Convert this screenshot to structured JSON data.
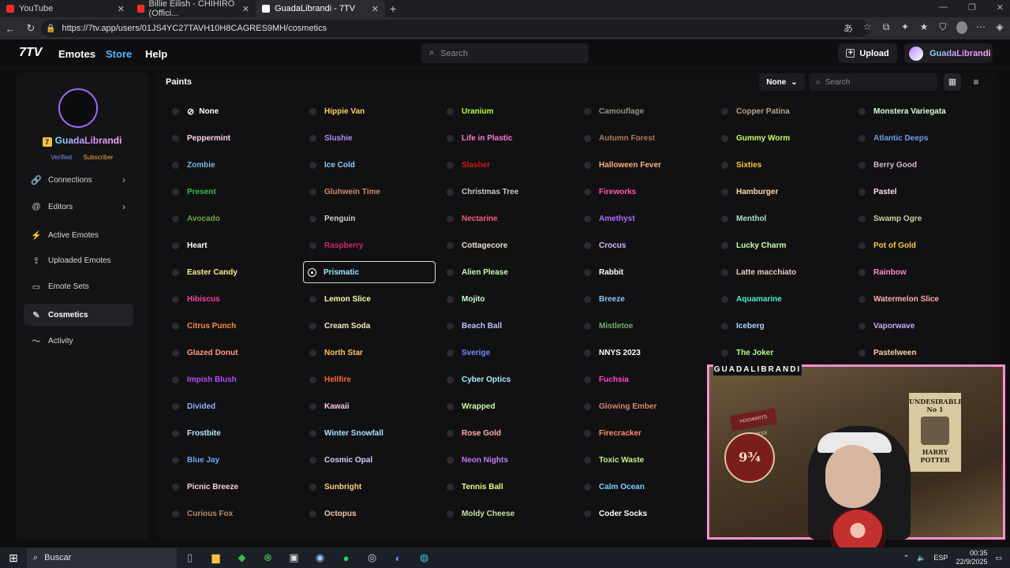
{
  "browser": {
    "tabs": [
      {
        "title": "YouTube",
        "fav_color": "#ff2b2b"
      },
      {
        "title": "Billie Eilish - CHIHIRO (Offici...",
        "fav_color": "#ff2b2b"
      },
      {
        "title": "GuadaLibrandi - 7TV",
        "fav_color": "#ffffff"
      }
    ],
    "url": "https://7tv.app/users/01JS4YC27TAVH10H8CAGRES9MH/cosmetics"
  },
  "header": {
    "logo": "7TV",
    "nav": [
      "Emotes",
      "Store",
      "Help"
    ],
    "search_placeholder": "Search",
    "upload_label": "Upload",
    "username": "GuadaLibrandi"
  },
  "sidebar": {
    "username": "GuadaLibrandi",
    "badges": [
      "Verified",
      "Subscriber"
    ],
    "items": [
      {
        "label": "Connections",
        "icon": "link-icon",
        "glyph": "🔗",
        "chevron": true
      },
      {
        "label": "Editors",
        "icon": "at-icon",
        "glyph": "@",
        "chevron": true
      },
      {
        "label": "Active Emotes",
        "icon": "bolt-icon",
        "glyph": "⚡",
        "chevron": false
      },
      {
        "label": "Uploaded Emotes",
        "icon": "upload-icon",
        "glyph": "⇪",
        "chevron": false
      },
      {
        "label": "Emote Sets",
        "icon": "folder-icon",
        "glyph": "▭",
        "chevron": false
      },
      {
        "label": "Cosmetics",
        "icon": "brush-icon",
        "glyph": "✎",
        "chevron": false,
        "active": true
      },
      {
        "label": "Activity",
        "icon": "activity-icon",
        "glyph": "〜",
        "chevron": false
      }
    ]
  },
  "main": {
    "title": "Paints",
    "filter_label": "None",
    "search_placeholder": "Search",
    "columns": [
      [
        {
          "name": "None",
          "color": "#ffffff"
        },
        {
          "name": "Peppermint",
          "color": "#ffd6e8"
        },
        {
          "name": "Zombie",
          "color": "#7fb6d8"
        },
        {
          "name": "Present",
          "color": "#2fbf4a"
        },
        {
          "name": "Avocado",
          "color": "#6faa3a"
        },
        {
          "name": "Heart",
          "color": "#ffffff"
        },
        {
          "name": "Easter Candy",
          "color": "#f7f08a"
        },
        {
          "name": "Hibiscus",
          "color": "#ff3fa4"
        },
        {
          "name": "Citrus Punch",
          "color": "#ff8a3d"
        },
        {
          "name": "Glazed Donut",
          "color": "#ff9b7a"
        },
        {
          "name": "Impish Blush",
          "color": "#b54cff"
        },
        {
          "name": "Divided",
          "color": "#8fb0ff"
        },
        {
          "name": "Frostbite",
          "color": "#bfe4ff"
        },
        {
          "name": "Blue Jay",
          "color": "#6ea8ff"
        },
        {
          "name": "Picnic Breeze",
          "color": "#ffd0d0"
        },
        {
          "name": "Curious Fox",
          "color": "#b88a6a"
        }
      ],
      [
        {
          "name": "Hippie Van",
          "color": "#f5d56a"
        },
        {
          "name": "Slushie",
          "color": "#b889ff"
        },
        {
          "name": "Ice Cold",
          "color": "#8fd0ff"
        },
        {
          "name": "Gluhwein Time",
          "color": "#d08a6a"
        },
        {
          "name": "Penguin",
          "color": "#cfcfcf"
        },
        {
          "name": "Raspberry",
          "color": "#d6246a"
        },
        {
          "name": "Prismatic",
          "color": "#9be7ff"
        },
        {
          "name": "Lemon Slice",
          "color": "#fff6a8"
        },
        {
          "name": "Cream Soda",
          "color": "#ffe7c2"
        },
        {
          "name": "North Star",
          "color": "#ffc15a"
        },
        {
          "name": "Hellfire",
          "color": "#ff6a2a"
        },
        {
          "name": "Kawaii",
          "color": "#ffc6f2"
        },
        {
          "name": "Winter Snowfall",
          "color": "#a8e4ff"
        },
        {
          "name": "Cosmic Opal",
          "color": "#d7d0ff"
        },
        {
          "name": "Sunbright",
          "color": "#ffd27a"
        },
        {
          "name": "Octopus",
          "color": "#f0c7b0"
        }
      ],
      [
        {
          "name": "Uranium",
          "color": "#b6ff3a"
        },
        {
          "name": "Life in Plastic",
          "color": "#ff7ad0"
        },
        {
          "name": "Slasher",
          "color": "#d21a1a"
        },
        {
          "name": "Christmas Tree",
          "color": "#c9c9c9"
        },
        {
          "name": "Nectarine",
          "color": "#ff5a7a"
        },
        {
          "name": "Cottagecore",
          "color": "#e8e0d0"
        },
        {
          "name": "Alien Please",
          "color": "#c6ffb0"
        },
        {
          "name": "Mojito",
          "color": "#c8ffd0"
        },
        {
          "name": "Beach Ball",
          "color": "#bfbfff"
        },
        {
          "name": "Sverige",
          "color": "#6a8fff"
        },
        {
          "name": "Cyber Optics",
          "color": "#a8f0ff"
        },
        {
          "name": "Wrapped",
          "color": "#c8ff9a"
        },
        {
          "name": "Rose Gold",
          "color": "#ffb0a8"
        },
        {
          "name": "Neon Nights",
          "color": "#c47bff"
        },
        {
          "name": "Tennis Ball",
          "color": "#e6ff7a"
        },
        {
          "name": "Moldy Cheese",
          "color": "#c8e0a0"
        }
      ],
      [
        {
          "name": "Camouflage",
          "color": "#8a9a7a"
        },
        {
          "name": "Autumn Forest",
          "color": "#b07a5a"
        },
        {
          "name": "Halloween Fever",
          "color": "#ffb07a"
        },
        {
          "name": "Fireworks",
          "color": "#ff5ab0"
        },
        {
          "name": "Amethyst",
          "color": "#b06aff"
        },
        {
          "name": "Crocus",
          "color": "#d8b8ff"
        },
        {
          "name": "Rabbit",
          "color": "#ffffff"
        },
        {
          "name": "Breeze",
          "color": "#8ac8ff"
        },
        {
          "name": "Mistletoe",
          "color": "#6ab06a"
        },
        {
          "name": "NNYS 2023",
          "color": "#ffffff"
        },
        {
          "name": "Fuchsia",
          "color": "#ff4ac8"
        },
        {
          "name": "Glowing Ember",
          "color": "#d8846a"
        },
        {
          "name": "Firecracker",
          "color": "#ff8a6a"
        },
        {
          "name": "Toxic Waste",
          "color": "#c8f08a"
        },
        {
          "name": "Calm Ocean",
          "color": "#7ad0ff"
        },
        {
          "name": "Coder Socks",
          "color": "#ffffff"
        }
      ],
      [
        {
          "name": "Copper Patina",
          "color": "#b8a488"
        },
        {
          "name": "Gummy Worm",
          "color": "#c8ff6a"
        },
        {
          "name": "Sixties",
          "color": "#ffc83a"
        },
        {
          "name": "Hamburger",
          "color": "#ffd9a8"
        },
        {
          "name": "Menthol",
          "color": "#a8e6c8"
        },
        {
          "name": "Lucky Charm",
          "color": "#c8ffb0"
        },
        {
          "name": "Latte macchiato",
          "color": "#e8d0b8"
        },
        {
          "name": "Aquamarine",
          "color": "#4af0d0"
        },
        {
          "name": "Iceberg",
          "color": "#a8d8ff"
        },
        {
          "name": "The Joker",
          "color": "#b0ff8a"
        }
      ],
      [
        {
          "name": "Monstera Variegata",
          "color": "#d8ffd0"
        },
        {
          "name": "Atlantic Deeps",
          "color": "#6aa0e8"
        },
        {
          "name": "Berry Good",
          "color": "#d8b8c8"
        },
        {
          "name": "Pastel",
          "color": "#ffe0f0"
        },
        {
          "name": "Swamp Ogre",
          "color": "#c8d8a0"
        },
        {
          "name": "Pot of Gold",
          "color": "#ffc84a"
        },
        {
          "name": "Rainbow",
          "color": "#ff8ad0"
        },
        {
          "name": "Watermelon Slice",
          "color": "#ffb0a0"
        },
        {
          "name": "Vaporwave",
          "color": "#d0a8ff"
        },
        {
          "name": "Pastelween",
          "color": "#ffd0a0"
        }
      ]
    ],
    "selected": "Prismatic"
  },
  "stream": {
    "overlay_label": "GUADALIBRANDI",
    "poster_title": "UNDESIRABLE",
    "poster_no": "No 1",
    "poster_name": "HARRY POTTER",
    "platform_text": "9¾",
    "hogwarts_text": "HOGWARTS EXPRESS"
  },
  "taskbar": {
    "search_placeholder": "Buscar",
    "lang": "ESP",
    "time": "00:35",
    "date": "22/9/2025"
  }
}
